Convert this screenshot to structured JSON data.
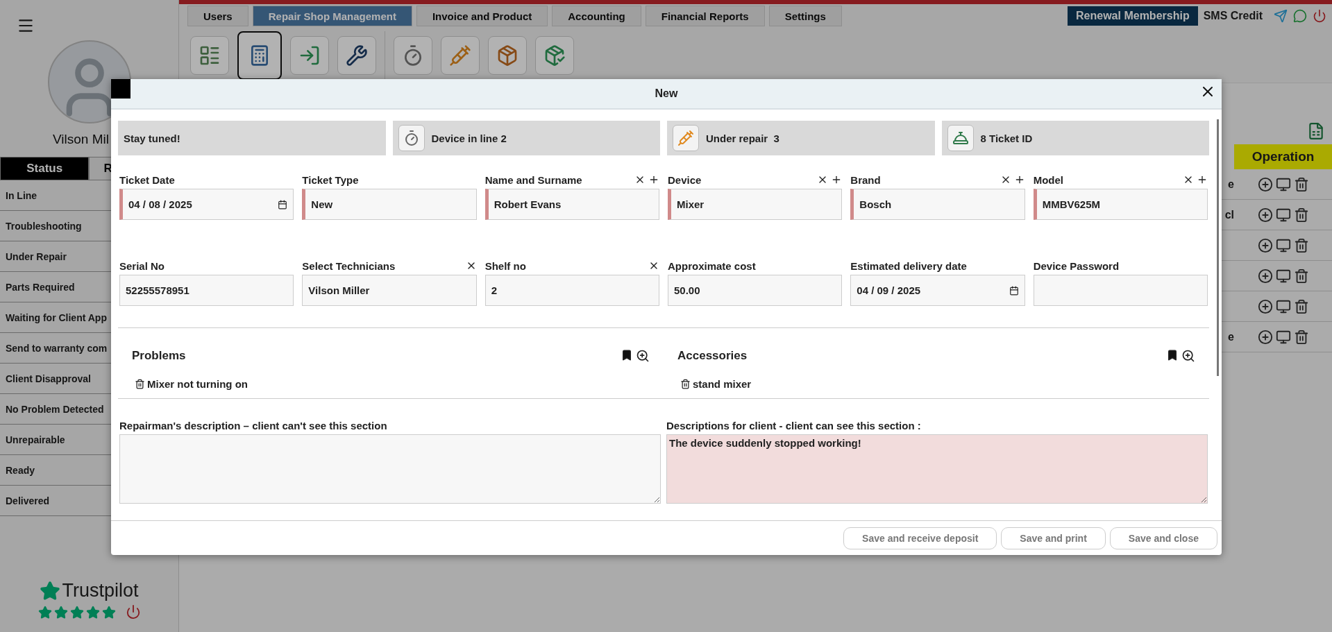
{
  "top_tabs": [
    {
      "label": "Users",
      "selected": false
    },
    {
      "label": "Repair Shop Management",
      "selected": true
    },
    {
      "label": "Invoice and Product",
      "selected": false
    },
    {
      "label": "Accounting",
      "selected": false
    },
    {
      "label": "Financial Reports",
      "selected": false
    },
    {
      "label": "Settings",
      "selected": false
    }
  ],
  "header_right": {
    "membership_button": "Renewal Membership",
    "sms_credit": "SMS Credit"
  },
  "toolbar": [
    {
      "kind": "shelves",
      "selected": false
    },
    {
      "kind": "calculator",
      "selected": true
    },
    {
      "kind": "enter",
      "selected": false
    },
    {
      "kind": "tools",
      "selected": false
    },
    {
      "kind": "timer",
      "selected": false
    },
    {
      "kind": "repair",
      "selected": false
    },
    {
      "kind": "box",
      "selected": false
    },
    {
      "kind": "boxcheck",
      "selected": false
    }
  ],
  "sidebar": {
    "user_name": "Vilson Mil",
    "tabs": [
      {
        "label": "Status",
        "selected": true
      },
      {
        "label": "R",
        "selected": false
      }
    ],
    "items": [
      "In Line",
      "Troubleshooting",
      "Under Repair",
      "Parts Required",
      "Waiting for Client App",
      "Send to warranty com",
      "Client Disapproval",
      "No Problem Detected",
      "Unrepairable",
      "Ready",
      "Delivered"
    ],
    "trustpilot": {
      "brand": "Trustpilot",
      "stars": 5
    }
  },
  "table": {
    "header": "Operation",
    "rows": [
      {
        "column_1": "e"
      },
      {
        "column_1": "cl"
      },
      {},
      {},
      {},
      {
        "column_1": "e"
      }
    ]
  },
  "modal": {
    "title": "New",
    "summary": [
      {
        "kind": "plain",
        "text": "Stay tuned!"
      },
      {
        "kind": "timer",
        "text": "Device in line 2"
      },
      {
        "kind": "repair",
        "text": "Under repair  3"
      },
      {
        "kind": "bell",
        "text": "8 Ticket ID"
      }
    ],
    "fields": [
      {
        "label": "Ticket Date",
        "value": "04 / 08 / 2025",
        "kind": "date",
        "required": true,
        "clearable": false,
        "addable": false
      },
      {
        "label": "Ticket Type",
        "value": "New",
        "kind": "text",
        "required": true,
        "clearable": false,
        "addable": false
      },
      {
        "label": "Name and Surname",
        "value": "Robert Evans",
        "kind": "text",
        "required": true,
        "clearable": true,
        "addable": true
      },
      {
        "label": "Device",
        "value": "Mixer",
        "kind": "text",
        "required": true,
        "clearable": true,
        "addable": true
      },
      {
        "label": "Brand",
        "value": "Bosch",
        "kind": "text",
        "required": true,
        "clearable": true,
        "addable": true
      },
      {
        "label": "Model",
        "value": "MMBV625M",
        "kind": "text",
        "required": true,
        "clearable": true,
        "addable": true
      },
      {
        "label": "Serial No",
        "value": "52255578951",
        "kind": "text",
        "required": false,
        "clearable": false,
        "addable": false
      },
      {
        "label": "Select Technicians",
        "value": "Vilson Miller",
        "kind": "text",
        "required": false,
        "clearable": true,
        "addable": false
      },
      {
        "label": "Shelf no",
        "value": "2",
        "kind": "text",
        "required": false,
        "clearable": true,
        "addable": false
      },
      {
        "label": "Approximate cost",
        "value": "50.00",
        "kind": "text",
        "required": false,
        "clearable": false,
        "addable": false
      },
      {
        "label": "Estimated delivery date",
        "value": "04 / 09 / 2025",
        "kind": "date",
        "required": false,
        "clearable": false,
        "addable": false
      },
      {
        "label": "Device Password",
        "kind": "text",
        "required": false,
        "clearable": false,
        "addable": false
      }
    ],
    "lists": [
      {
        "title": "Problems",
        "items": [
          "Mixer not turning on"
        ]
      },
      {
        "title": "Accessories",
        "items": [
          "stand mixer"
        ]
      }
    ],
    "descriptions": [
      {
        "label": "Repairman's description – client can't see this section",
        "highlighted": false
      },
      {
        "label": "Descriptions for client - client can see this section :",
        "value": "The device suddenly stopped working!",
        "highlighted": true
      }
    ],
    "buttons": [
      "Save and receive deposit",
      "Save and print",
      "Save and close"
    ]
  }
}
